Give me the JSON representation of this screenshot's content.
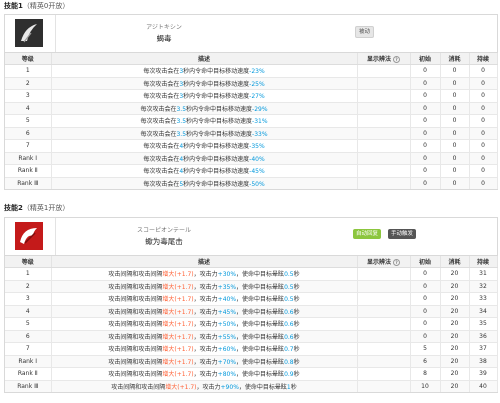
{
  "skill1": {
    "section_title": "技能1",
    "section_sub": "（精英0开放）",
    "katakana": "アジトキシン",
    "name": "蝎毒",
    "badge": "被动",
    "headers": {
      "level": "等级",
      "desc": "描述",
      "display": "显示辨法",
      "init": "初始",
      "cost": "消耗",
      "dur": "持续"
    },
    "rows": [
      {
        "level": "1",
        "pre": "每次攻击会在",
        "sec": "3",
        "mid": "秒内令命中目标移动速度",
        "val": "-23%",
        "init": "0",
        "cost": "0",
        "dur": "0"
      },
      {
        "level": "2",
        "pre": "每次攻击会在",
        "sec": "3",
        "mid": "秒内令命中目标移动速度",
        "val": "-25%",
        "init": "0",
        "cost": "0",
        "dur": "0"
      },
      {
        "level": "3",
        "pre": "每次攻击会在",
        "sec": "3",
        "mid": "秒内令命中目标移动速度",
        "val": "-27%",
        "init": "0",
        "cost": "0",
        "dur": "0"
      },
      {
        "level": "4",
        "pre": "每次攻击会在",
        "sec": "3.5",
        "mid": "秒内令命中目标移动速度",
        "val": "-29%",
        "init": "0",
        "cost": "0",
        "dur": "0"
      },
      {
        "level": "5",
        "pre": "每次攻击会在",
        "sec": "3.5",
        "mid": "秒内令命中目标移动速度",
        "val": "-31%",
        "init": "0",
        "cost": "0",
        "dur": "0"
      },
      {
        "level": "6",
        "pre": "每次攻击会在",
        "sec": "3.5",
        "mid": "秒内令命中目标移动速度",
        "val": "-33%",
        "init": "0",
        "cost": "0",
        "dur": "0"
      },
      {
        "level": "7",
        "pre": "每次攻击会在",
        "sec": "4",
        "mid": "秒内令命中目标移动速度",
        "val": "-35%",
        "init": "0",
        "cost": "0",
        "dur": "0"
      },
      {
        "level": "Rank Ⅰ",
        "pre": "每次攻击会在",
        "sec": "4",
        "mid": "秒内令命中目标移动速度",
        "val": "-40%",
        "init": "0",
        "cost": "0",
        "dur": "0"
      },
      {
        "level": "Rank Ⅱ",
        "pre": "每次攻击会在",
        "sec": "4",
        "mid": "秒内令命中目标移动速度",
        "val": "-45%",
        "init": "0",
        "cost": "0",
        "dur": "0"
      },
      {
        "level": "Rank Ⅲ",
        "pre": "每次攻击会在",
        "sec": "5",
        "mid": "秒内令命中目标移动速度",
        "val": "-50%",
        "init": "0",
        "cost": "0",
        "dur": "0"
      }
    ]
  },
  "skill2": {
    "section_title": "技能2",
    "section_sub": "（精英1开放）",
    "katakana": "スコーピオンテール",
    "name": "蠍为毒尾击",
    "badge_auto": "自动回复",
    "badge_manual": "手动触发",
    "headers": {
      "level": "等级",
      "desc": "描述",
      "display": "显示辨法",
      "init": "初始",
      "cost": "消耗",
      "dur": "持续"
    },
    "rows": [
      {
        "level": "1",
        "pre": "攻击间隔和攻击间隔",
        "mod": "增大(+1.7)",
        "mid": "，攻击力",
        "atk": "+30%",
        "post": "，使命中目标晕眩",
        "stun": "0.5",
        "end": "秒",
        "init": "0",
        "cost": "20",
        "dur": "31"
      },
      {
        "level": "2",
        "pre": "攻击间隔和攻击间隔",
        "mod": "增大(+1.7)",
        "mid": "，攻击力",
        "atk": "+35%",
        "post": "，使命中目标晕眩",
        "stun": "0.5",
        "end": "秒",
        "init": "0",
        "cost": "20",
        "dur": "32"
      },
      {
        "level": "3",
        "pre": "攻击间隔和攻击间隔",
        "mod": "增大(+1.7)",
        "mid": "，攻击力",
        "atk": "+40%",
        "post": "，使命中目标晕眩",
        "stun": "0.5",
        "end": "秒",
        "init": "0",
        "cost": "20",
        "dur": "33"
      },
      {
        "level": "4",
        "pre": "攻击间隔和攻击间隔",
        "mod": "增大(+1.7)",
        "mid": "，攻击力",
        "atk": "+45%",
        "post": "，使命中目标晕眩",
        "stun": "0.6",
        "end": "秒",
        "init": "0",
        "cost": "20",
        "dur": "34"
      },
      {
        "level": "5",
        "pre": "攻击间隔和攻击间隔",
        "mod": "增大(+1.7)",
        "mid": "，攻击力",
        "atk": "+50%",
        "post": "，使命中目标晕眩",
        "stun": "0.6",
        "end": "秒",
        "init": "0",
        "cost": "20",
        "dur": "35"
      },
      {
        "level": "6",
        "pre": "攻击间隔和攻击间隔",
        "mod": "增大(+1.7)",
        "mid": "，攻击力",
        "atk": "+55%",
        "post": "，使命中目标晕眩",
        "stun": "0.6",
        "end": "秒",
        "init": "0",
        "cost": "20",
        "dur": "36"
      },
      {
        "level": "7",
        "pre": "攻击间隔和攻击间隔",
        "mod": "增大(+1.7)",
        "mid": "，攻击力",
        "atk": "+60%",
        "post": "，使命中目标晕眩",
        "stun": "0.7",
        "end": "秒",
        "init": "5",
        "cost": "20",
        "dur": "37"
      },
      {
        "level": "Rank Ⅰ",
        "pre": "攻击间隔和攻击间隔",
        "mod": "增大(+1.7)",
        "mid": "，攻击力",
        "atk": "+70%",
        "post": "，使命中目标晕眩",
        "stun": "0.8",
        "end": "秒",
        "init": "6",
        "cost": "20",
        "dur": "38"
      },
      {
        "level": "Rank Ⅱ",
        "pre": "攻击间隔和攻击间隔",
        "mod": "增大(+1.7)",
        "mid": "，攻击力",
        "atk": "+80%",
        "post": "，使命中目标晕眩",
        "stun": "0.9",
        "end": "秒",
        "init": "8",
        "cost": "20",
        "dur": "39"
      },
      {
        "level": "Rank Ⅲ",
        "pre": "攻击间隔和攻击间隔",
        "mod": "增大(+1.7)",
        "mid": "，攻击力",
        "atk": "+90%",
        "post": "，使命中目标晕眩",
        "stun": "1",
        "end": "秒",
        "init": "10",
        "cost": "20",
        "dur": "40"
      }
    ]
  },
  "colors": {
    "highlight": "#0098dc",
    "modifier": "#ff6237",
    "auto_badge": "#8cc63e",
    "manual_badge": "#555555"
  }
}
